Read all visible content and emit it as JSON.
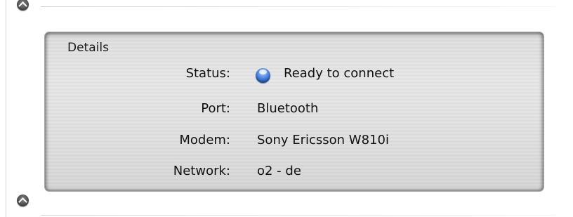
{
  "details": {
    "title": "Details",
    "rows": [
      {
        "label": "Status:",
        "value": "Ready to connect",
        "status_color": "#3a72d6"
      },
      {
        "label": "Port:",
        "value": "Bluetooth"
      },
      {
        "label": "Modem:",
        "value": "Sony Ericsson W810i"
      },
      {
        "label": "Network:",
        "value": "o2 - de"
      }
    ]
  },
  "icons": {
    "top_disclosure": "chevron-up-icon",
    "bottom_disclosure": "chevron-up-icon",
    "status_indicator": "status-orb-icon"
  }
}
